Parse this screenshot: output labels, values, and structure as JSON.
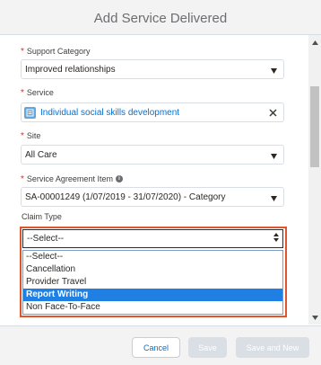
{
  "modal": {
    "title": "Add Service Delivered"
  },
  "fields": {
    "support_category": {
      "label": "Support Category",
      "value": "Improved relationships"
    },
    "service": {
      "label": "Service",
      "value": "Individual social skills development"
    },
    "site": {
      "label": "Site",
      "value": "All Care"
    },
    "service_agreement_item": {
      "label": "Service Agreement Item",
      "value": "SA-00001249 (1/07/2019 - 31/07/2020) - Category"
    },
    "claim_type": {
      "label": "Claim Type",
      "value": "--Select--",
      "options": [
        "--Select--",
        "Cancellation",
        "Provider Travel",
        "Report Writing",
        "Non Face-To-Face"
      ],
      "highlighted_option": "Report Writing"
    }
  },
  "required_marker": "*",
  "footer": {
    "cancel_label": "Cancel",
    "save_label": "Save",
    "save_new_label": "Save and New"
  },
  "colors": {
    "highlight_border": "#e0552c",
    "selected_option": "#1f7fe3",
    "link_blue": "#0070d2",
    "required": "#c23934"
  },
  "icons": {
    "service_record": "record-icon",
    "info": "info-icon",
    "clear": "close-icon"
  }
}
